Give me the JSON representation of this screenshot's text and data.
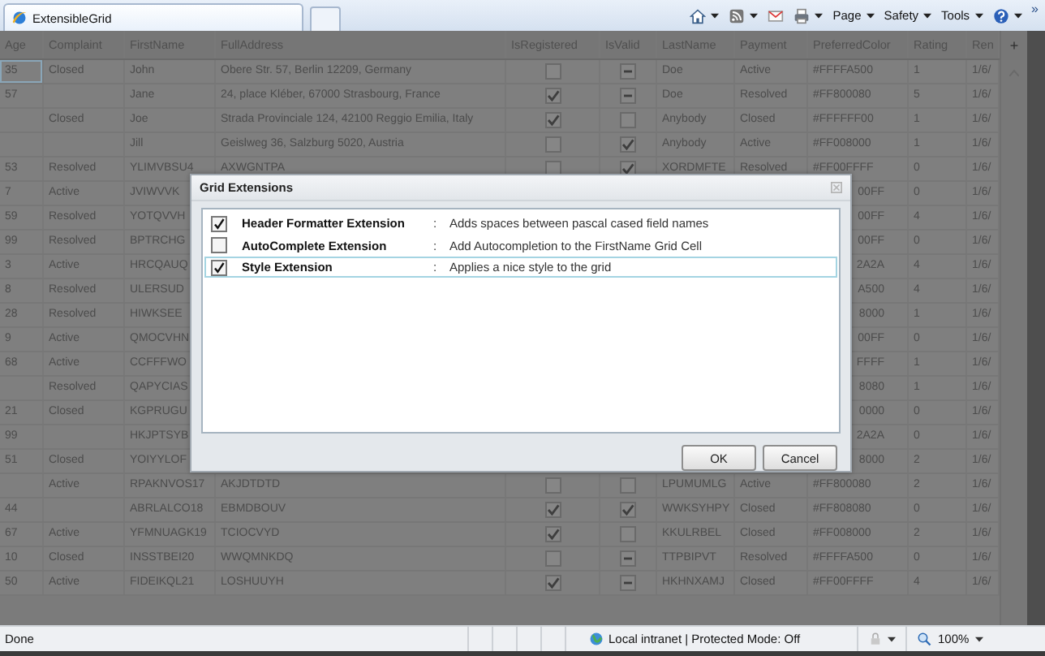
{
  "browser": {
    "tab_title": "ExtensibleGrid",
    "toolbar": [
      {
        "kind": "home",
        "dropdown": true
      },
      {
        "kind": "feeds",
        "dropdown": true
      },
      {
        "kind": "mail",
        "dropdown": false
      },
      {
        "kind": "print",
        "dropdown": true
      },
      {
        "kind": "menu",
        "label": "Page",
        "dropdown": true
      },
      {
        "kind": "menu",
        "label": "Safety",
        "dropdown": true
      },
      {
        "kind": "menu",
        "label": "Tools",
        "dropdown": true
      },
      {
        "kind": "help",
        "dropdown": true
      }
    ],
    "overflow": "»"
  },
  "grid": {
    "columns": [
      "Age",
      "Complaint",
      "FirstName",
      "FullAddress",
      "IsRegistered",
      "IsValid",
      "LastName",
      "Payment",
      "PreferredColor",
      "Rating",
      "Ren"
    ],
    "add_column": "+",
    "rows": [
      {
        "kind": "full",
        "selected": true,
        "age": "35",
        "complaint": "Closed",
        "first_name": "John",
        "full_address": "Obere Str. 57, Berlin 12209, Germany",
        "is_registered": false,
        "is_valid_indeterminate": true,
        "last_name": "Doe",
        "payment": "Active",
        "preferred_color": "#FFFFA500",
        "rating": "1",
        "renew": "1/6/"
      },
      {
        "kind": "full",
        "selected": false,
        "age": "57",
        "first_name": "Jane",
        "full_address": "24, place Kléber, 67000 Strasbourg, France",
        "is_registered": true,
        "is_valid_indeterminate": true,
        "last_name": "Doe",
        "payment": "Resolved",
        "preferred_color": "#FF800080",
        "rating": "5",
        "renew": "1/6/"
      },
      {
        "kind": "full",
        "selected": false,
        "complaint": "Closed",
        "first_name": "Joe",
        "full_address": "Strada Provinciale 124, 42100 Reggio Emilia, Italy",
        "is_registered": true,
        "is_valid": false,
        "is_valid_indeterminate": false,
        "last_name": "Anybody",
        "payment": "Closed",
        "preferred_color": "#FFFFFF00",
        "rating": "1",
        "renew": "1/6/"
      },
      {
        "kind": "full",
        "selected": false,
        "first_name": "Jill",
        "full_address": "Geislweg 36, Salzburg 5020, Austria",
        "is_registered": false,
        "is_valid": true,
        "is_valid_indeterminate": false,
        "last_name": "Anybody",
        "payment": "Active",
        "preferred_color": "#FF008000",
        "rating": "1",
        "renew": "1/6/"
      },
      {
        "kind": "full",
        "selected": false,
        "age": "53",
        "complaint": "Resolved",
        "first_name": "YLIMVBSU4",
        "full_address": "AXWGNTPA",
        "is_registered": false,
        "is_valid": true,
        "is_valid_indeterminate": false,
        "last_name": "XORDMFTE",
        "payment": "Resolved",
        "preferred_color": "#FF00FFFF",
        "rating": "0",
        "renew": "1/6/"
      },
      {
        "kind": "covered",
        "selected": false,
        "age": "7",
        "complaint": "Active",
        "first_name": "JVIWVVK",
        "preferred_color": "00FF",
        "rating": "0",
        "renew": "1/6/"
      },
      {
        "kind": "covered",
        "selected": false,
        "age": "59",
        "complaint": "Resolved",
        "first_name": "YOTQVVH",
        "preferred_color": "00FF",
        "rating": "4",
        "renew": "1/6/"
      },
      {
        "kind": "covered",
        "selected": false,
        "age": "99",
        "complaint": "Resolved",
        "first_name": "BPTRCHG",
        "preferred_color": "00FF",
        "rating": "0",
        "renew": "1/6/"
      },
      {
        "kind": "covered",
        "selected": false,
        "age": "3",
        "complaint": "Active",
        "first_name": "HRCQAUQ",
        "preferred_color": "2A2A",
        "rating": "4",
        "renew": "1/6/"
      },
      {
        "kind": "covered",
        "selected": false,
        "age": "8",
        "complaint": "Resolved",
        "first_name": "ULERSUD",
        "preferred_color": "A500",
        "rating": "4",
        "renew": "1/6/"
      },
      {
        "kind": "covered",
        "selected": false,
        "age": "28",
        "complaint": "Resolved",
        "first_name": "HIWKSEE",
        "preferred_color": "8000",
        "rating": "1",
        "renew": "1/6/"
      },
      {
        "kind": "covered",
        "selected": false,
        "age": "9",
        "complaint": "Active",
        "first_name": "QMOCVHN",
        "preferred_color": "00FF",
        "rating": "0",
        "renew": "1/6/"
      },
      {
        "kind": "covered",
        "selected": false,
        "age": "68",
        "complaint": "Active",
        "first_name": "CCFFFWO",
        "preferred_color": "FFFF",
        "rating": "1",
        "renew": "1/6/"
      },
      {
        "kind": "covered",
        "selected": false,
        "complaint": "Resolved",
        "first_name": "QAPYCIAS",
        "preferred_color": "8080",
        "rating": "1",
        "renew": "1/6/"
      },
      {
        "kind": "covered",
        "selected": false,
        "age": "21",
        "complaint": "Closed",
        "first_name": "KGPRUGU",
        "preferred_color": "0000",
        "rating": "0",
        "renew": "1/6/"
      },
      {
        "kind": "covered",
        "selected": false,
        "age": "99",
        "first_name": "HKJPTSYB",
        "preferred_color": "2A2A",
        "rating": "0",
        "renew": "1/6/"
      },
      {
        "kind": "covered",
        "selected": false,
        "age": "51",
        "complaint": "Closed",
        "first_name": "YOIYYLOF",
        "preferred_color": "8000",
        "rating": "2",
        "renew": "1/6/"
      },
      {
        "kind": "full",
        "selected": false,
        "complaint": "Active",
        "first_name": "RPAKNVOS17",
        "full_address": "AKJDTDTD",
        "is_registered": false,
        "is_valid": false,
        "is_valid_indeterminate": false,
        "last_name": "LPUMUMLG",
        "payment": "Active",
        "preferred_color": "#FF800080",
        "rating": "2",
        "renew": "1/6/"
      },
      {
        "kind": "full",
        "selected": false,
        "age": "44",
        "first_name": "ABRLALCO18",
        "full_address": "EBMDBOUV",
        "is_registered": true,
        "is_valid": true,
        "is_valid_indeterminate": false,
        "last_name": "WWKSYHPY",
        "payment": "Closed",
        "preferred_color": "#FF808080",
        "rating": "0",
        "renew": "1/6/"
      },
      {
        "kind": "full",
        "selected": false,
        "age": "67",
        "complaint": "Active",
        "first_name": "YFMNUAGK19",
        "full_address": "TCIOCVYD",
        "is_registered": true,
        "is_valid": false,
        "is_valid_indeterminate": false,
        "last_name": "KKULRBEL",
        "payment": "Closed",
        "preferred_color": "#FF008000",
        "rating": "2",
        "renew": "1/6/"
      },
      {
        "kind": "full",
        "selected": false,
        "age": "10",
        "complaint": "Closed",
        "first_name": "INSSTBEI20",
        "full_address": "WWQMNKDQ",
        "is_registered": false,
        "is_valid_indeterminate": true,
        "last_name": "TTPBIPVT",
        "payment": "Resolved",
        "preferred_color": "#FFFFA500",
        "rating": "0",
        "renew": "1/6/"
      },
      {
        "kind": "full",
        "selected": false,
        "age": "50",
        "complaint": "Active",
        "first_name": "FIDEIKQL21",
        "full_address": "LOSHUUYH",
        "is_registered": true,
        "is_valid_indeterminate": true,
        "last_name": "HKHNXAMJ",
        "payment": "Closed",
        "preferred_color": "#FF00FFFF",
        "rating": "4",
        "renew": "1/6/"
      }
    ]
  },
  "dialog": {
    "title": "Grid Extensions",
    "items": [
      {
        "checked": true,
        "selected": false,
        "name": "Header Formatter Extension",
        "separator": ":",
        "description": "Adds spaces between pascal cased field names"
      },
      {
        "checked": false,
        "selected": false,
        "name": "AutoComplete Extension",
        "separator": ":",
        "description": "Add Autocompletion to the FirstName Grid Cell"
      },
      {
        "checked": true,
        "selected": true,
        "name": "Style Extension",
        "separator": ":",
        "description": "Applies a nice style to the grid"
      }
    ],
    "buttons": [
      "OK",
      "Cancel"
    ]
  },
  "status_bar": {
    "text": "Done",
    "zone": "Local intranet | Protected Mode: Off",
    "zoom": "100%"
  }
}
